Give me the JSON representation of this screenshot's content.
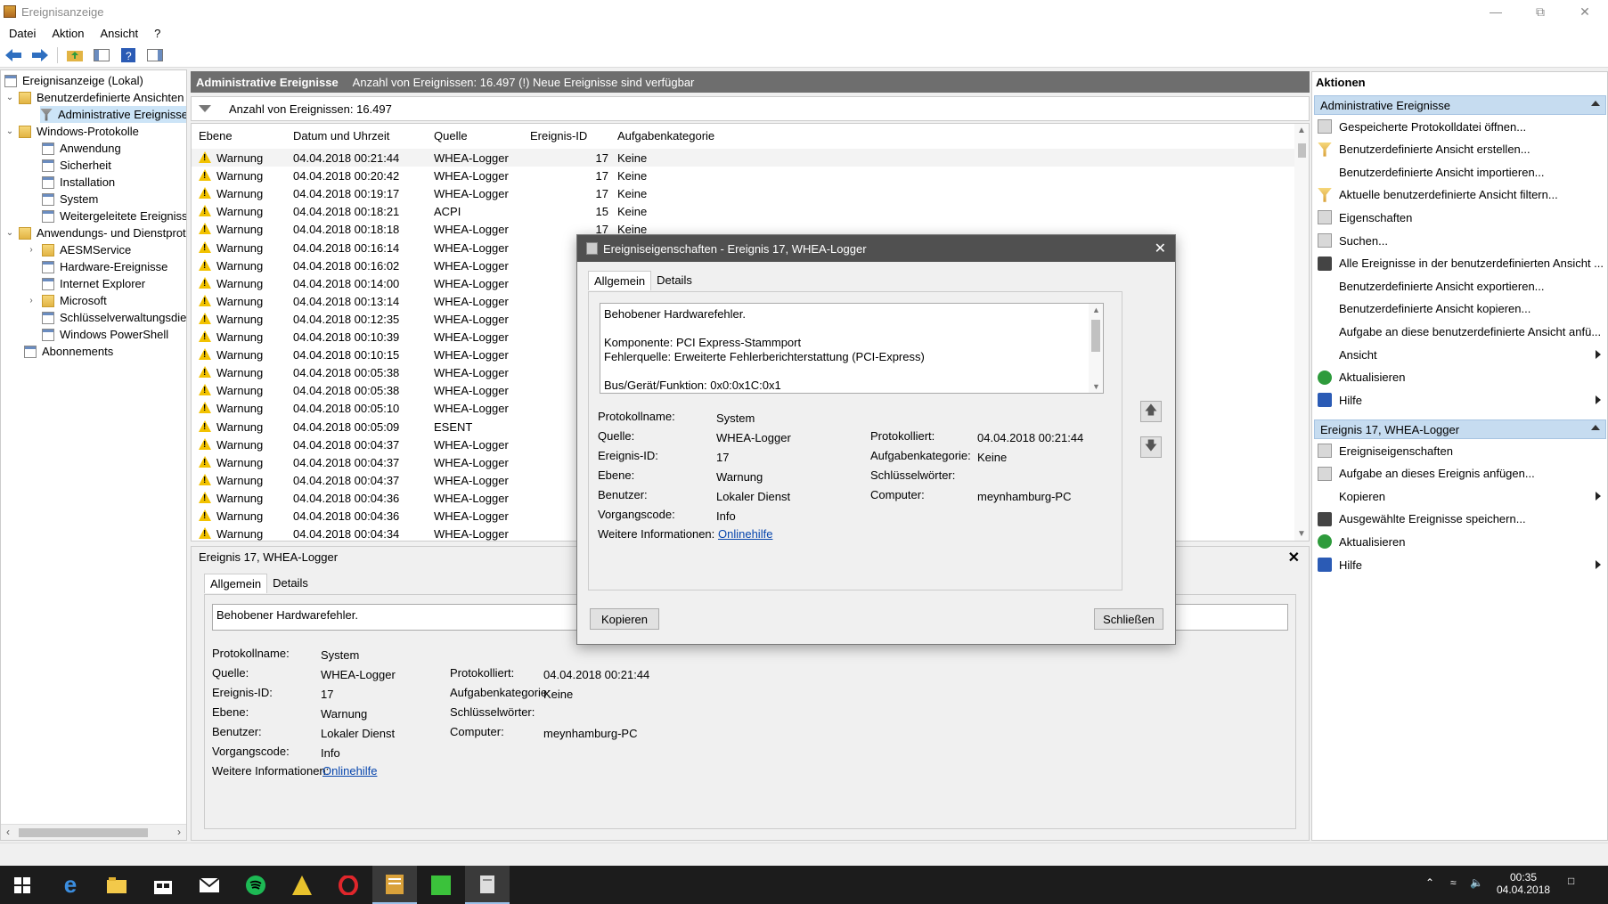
{
  "window": {
    "title": "Ereignisanzeige"
  },
  "menu": [
    "Datei",
    "Aktion",
    "Ansicht",
    "?"
  ],
  "tree": {
    "root": "Ereignisanzeige (Lokal)",
    "custom_views": "Benutzerdefinierte Ansichten",
    "admin_events": "Administrative Ereignisse",
    "windows_logs": "Windows-Protokolle",
    "app": "Anwendung",
    "security": "Sicherheit",
    "installation": "Installation",
    "system": "System",
    "forwarded": "Weitergeleitete Ereignisse",
    "app_services": "Anwendungs- und Dienstprotokolle",
    "aesm": "AESMService",
    "hardware": "Hardware-Ereignisse",
    "ie": "Internet Explorer",
    "microsoft": "Microsoft",
    "key_mgmt": "Schlüsselverwaltungsdienst",
    "powershell": "Windows PowerShell",
    "subscriptions": "Abonnements"
  },
  "center": {
    "header_title": "Administrative Ereignisse",
    "header_info": "Anzahl von Ereignissen: 16.497 (!) Neue Ereignisse sind verfügbar",
    "filter_text": "Anzahl von Ereignissen: 16.497",
    "columns": [
      "Ebene",
      "Datum und Uhrzeit",
      "Quelle",
      "Ereignis-ID",
      "Aufgabenkategorie"
    ],
    "rows": [
      [
        "Warnung",
        "04.04.2018 00:21:44",
        "WHEA-Logger",
        "17",
        "Keine"
      ],
      [
        "Warnung",
        "04.04.2018 00:20:42",
        "WHEA-Logger",
        "17",
        "Keine"
      ],
      [
        "Warnung",
        "04.04.2018 00:19:17",
        "WHEA-Logger",
        "17",
        "Keine"
      ],
      [
        "Warnung",
        "04.04.2018 00:18:21",
        "ACPI",
        "15",
        "Keine"
      ],
      [
        "Warnung",
        "04.04.2018 00:18:18",
        "WHEA-Logger",
        "17",
        "Keine"
      ],
      [
        "Warnung",
        "04.04.2018 00:16:14",
        "WHEA-Logger",
        "",
        ""
      ],
      [
        "Warnung",
        "04.04.2018 00:16:02",
        "WHEA-Logger",
        "",
        ""
      ],
      [
        "Warnung",
        "04.04.2018 00:14:00",
        "WHEA-Logger",
        "",
        ""
      ],
      [
        "Warnung",
        "04.04.2018 00:13:14",
        "WHEA-Logger",
        "",
        ""
      ],
      [
        "Warnung",
        "04.04.2018 00:12:35",
        "WHEA-Logger",
        "",
        ""
      ],
      [
        "Warnung",
        "04.04.2018 00:10:39",
        "WHEA-Logger",
        "",
        ""
      ],
      [
        "Warnung",
        "04.04.2018 00:10:15",
        "WHEA-Logger",
        "",
        ""
      ],
      [
        "Warnung",
        "04.04.2018 00:05:38",
        "WHEA-Logger",
        "",
        ""
      ],
      [
        "Warnung",
        "04.04.2018 00:05:38",
        "WHEA-Logger",
        "",
        ""
      ],
      [
        "Warnung",
        "04.04.2018 00:05:10",
        "WHEA-Logger",
        "",
        ""
      ],
      [
        "Warnung",
        "04.04.2018 00:05:09",
        "ESENT",
        "",
        ""
      ],
      [
        "Warnung",
        "04.04.2018 00:04:37",
        "WHEA-Logger",
        "",
        ""
      ],
      [
        "Warnung",
        "04.04.2018 00:04:37",
        "WHEA-Logger",
        "",
        ""
      ],
      [
        "Warnung",
        "04.04.2018 00:04:37",
        "WHEA-Logger",
        "",
        ""
      ],
      [
        "Warnung",
        "04.04.2018 00:04:36",
        "WHEA-Logger",
        "",
        ""
      ],
      [
        "Warnung",
        "04.04.2018 00:04:36",
        "WHEA-Logger",
        "",
        ""
      ],
      [
        "Warnung",
        "04.04.2018 00:04:34",
        "WHEA-Logger",
        "",
        ""
      ]
    ]
  },
  "details": {
    "title": "Ereignis 17, WHEA-Logger",
    "tab_general": "Allgemein",
    "tab_details": "Details",
    "message": "Behobener Hardwarefehler.",
    "labels": {
      "log_name": "Protokollname:",
      "source": "Quelle:",
      "event_id": "Ereignis-ID:",
      "level": "Ebene:",
      "user": "Benutzer:",
      "opcode": "Vorgangscode:",
      "more_info": "Weitere Informationen:",
      "logged": "Protokolliert:",
      "task_category": "Aufgabenkategorie:",
      "keywords": "Schlüsselwörter:",
      "computer": "Computer:"
    },
    "values": {
      "log_name": "System",
      "source": "WHEA-Logger",
      "event_id": "17",
      "level": "Warnung",
      "user": "Lokaler Dienst",
      "opcode": "Info",
      "more_info_link": "Onlinehilfe",
      "logged": "04.04.2018 00:21:44",
      "task_category": "Keine",
      "keywords": "",
      "computer": "meynhamburg-PC"
    }
  },
  "modal": {
    "title": "Ereigniseigenschaften - Ereignis 17, WHEA-Logger",
    "message_lines": [
      "Behobener Hardwarefehler.",
      "",
      "Komponente: PCI Express-Stammport",
      "Fehlerquelle: Erweiterte Fehlerberichterstattung (PCI-Express)",
      "",
      "Bus/Gerät/Funktion: 0x0:0x1C:0x1"
    ],
    "copy_button": "Kopieren",
    "close_button": "Schließen"
  },
  "actions": {
    "title": "Aktionen",
    "section1": "Administrative Ereignisse",
    "items1": [
      "Gespeicherte Protokolldatei öffnen...",
      "Benutzerdefinierte Ansicht erstellen...",
      "Benutzerdefinierte Ansicht importieren...",
      "Aktuelle benutzerdefinierte Ansicht filtern...",
      "Eigenschaften",
      "Suchen...",
      "Alle Ereignisse in der benutzerdefinierten Ansicht ...",
      "Benutzerdefinierte Ansicht exportieren...",
      "Benutzerdefinierte Ansicht kopieren...",
      "Aufgabe an diese benutzerdefinierte Ansicht anfü...",
      "Ansicht",
      "Aktualisieren",
      "Hilfe"
    ],
    "section2": "Ereignis 17, WHEA-Logger",
    "items2": [
      "Ereigniseigenschaften",
      "Aufgabe an dieses Ereignis anfügen...",
      "Kopieren",
      "Ausgewählte Ereignisse speichern...",
      "Aktualisieren",
      "Hilfe"
    ]
  },
  "taskbar": {
    "time": "00:35",
    "date": "04.04.2018"
  },
  "colors": {
    "accent": "#0645ad",
    "section_bg": "#c6dcf0",
    "warn": "#f2c200"
  }
}
